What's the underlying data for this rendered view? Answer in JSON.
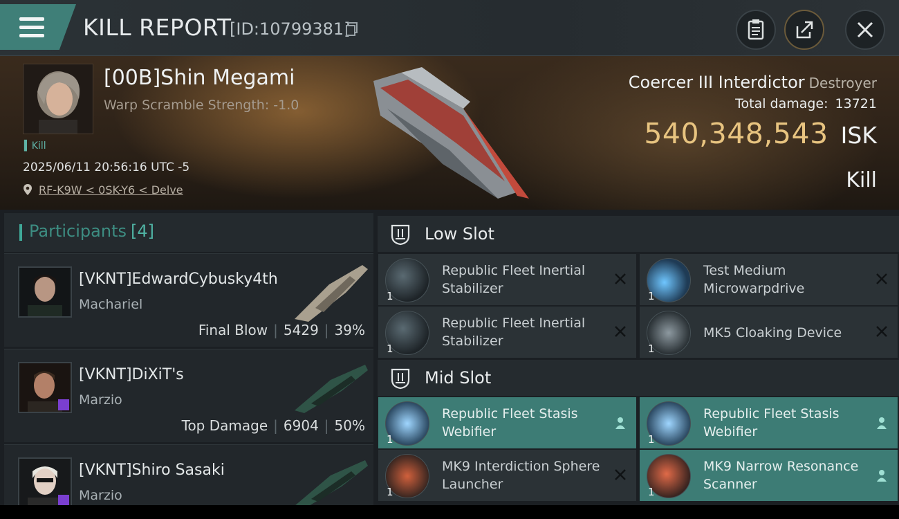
{
  "header": {
    "title": "KILL REPORT",
    "report_id": "[ID:10799381]"
  },
  "victim": {
    "pilot": "[00B]Shin Megami",
    "warp_scramble": "Warp Scramble Strength: -1.0",
    "kill_tag": "Kill",
    "time": "2025/06/11 20:56:16 UTC -5",
    "location": "RF-K9W < 0SK-Y6 < Delve",
    "ship": "Coercer III Interdictor",
    "ship_class": "Destroyer",
    "total_damage_label": "Total damage:",
    "total_damage": "13721",
    "isk_value": "540,348,543",
    "isk_unit": "ISK",
    "result": "Kill"
  },
  "participants": {
    "title": "Participants",
    "count": "[4]",
    "items": [
      {
        "name": "[VKNT]EdwardCybusky4th",
        "ship": "Machariel",
        "tag": "Final Blow",
        "damage": "5429",
        "percent": "39%"
      },
      {
        "name": "[VKNT]DiXiT's",
        "ship": "Marzio",
        "tag": "Top Damage",
        "damage": "6904",
        "percent": "50%"
      },
      {
        "name": "[VKNT]Shiro Sasaki",
        "ship": "Marzio"
      }
    ]
  },
  "slots": {
    "low": {
      "title": "Low Slot",
      "modules": [
        {
          "name": "Republic Fleet Inertial Stabilizer",
          "qty": "1",
          "status": "x",
          "icon": "inertial-stabilizer-icon"
        },
        {
          "name": "Test Medium Microwarpdrive",
          "qty": "1",
          "status": "x",
          "icon": "microwarpdrive-icon"
        },
        {
          "name": "Republic Fleet Inertial Stabilizer",
          "qty": "1",
          "status": "x",
          "icon": "inertial-stabilizer-icon"
        },
        {
          "name": "MK5 Cloaking Device",
          "qty": "1",
          "status": "x",
          "icon": "cloaking-device-icon"
        }
      ]
    },
    "mid": {
      "title": "Mid Slot",
      "modules": [
        {
          "name": "Republic Fleet Stasis Webifier",
          "qty": "1",
          "status": "user",
          "icon": "stasis-webifier-icon"
        },
        {
          "name": "Republic Fleet Stasis Webifier",
          "qty": "1",
          "status": "user",
          "icon": "stasis-webifier-icon"
        },
        {
          "name": "MK9 Interdiction Sphere Launcher",
          "qty": "1",
          "status": "x",
          "icon": "interdiction-launcher-icon"
        },
        {
          "name": "MK9 Narrow Resonance Scanner",
          "qty": "1",
          "status": "user",
          "icon": "resonance-scanner-icon"
        }
      ]
    }
  },
  "colors": {
    "accent_teal": "#3d7c75",
    "isk_gold": "#e8c480",
    "badge_purple": "#7a3fd0"
  }
}
